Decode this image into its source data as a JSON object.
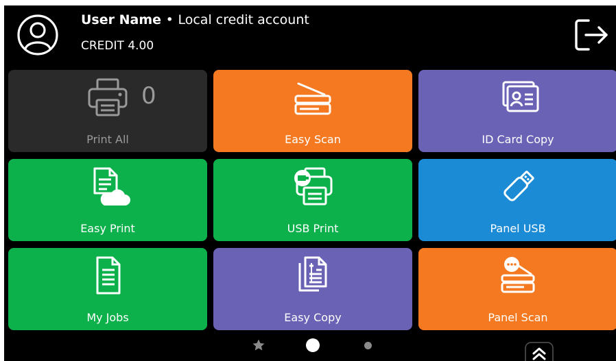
{
  "header": {
    "user_name": "User Name",
    "separator": "•",
    "account_type": "Local credit account",
    "credit_text": "CREDIT 4.00"
  },
  "tiles": [
    {
      "label": "Print All",
      "color": "#2a2a2a",
      "icon": "printer-icon",
      "counter": "0",
      "enabled": false
    },
    {
      "label": "Easy Scan",
      "color": "#f47920",
      "icon": "scanner-icon",
      "enabled": true
    },
    {
      "label": "ID Card Copy",
      "color": "#6a62b5",
      "icon": "id-card-icon",
      "enabled": true
    },
    {
      "label": "Easy Print",
      "color": "#0db14b",
      "icon": "cloud-document-icon",
      "enabled": true
    },
    {
      "label": "USB Print",
      "color": "#0db14b",
      "icon": "usb-printer-icon",
      "enabled": true
    },
    {
      "label": "Panel USB",
      "color": "#1b8bd6",
      "icon": "usb-drive-icon",
      "enabled": true
    },
    {
      "label": "My Jobs",
      "color": "#0db14b",
      "icon": "document-icon",
      "enabled": true
    },
    {
      "label": "Easy Copy",
      "color": "#6a62b5",
      "icon": "copy-documents-icon",
      "enabled": true
    },
    {
      "label": "Panel Scan",
      "color": "#f47920",
      "icon": "panel-scanner-icon",
      "enabled": true
    }
  ],
  "pager": {
    "pages": 2,
    "active_page": 1,
    "favorites_icon": "star-icon"
  },
  "expand_icon": "chevron-double-up-icon"
}
